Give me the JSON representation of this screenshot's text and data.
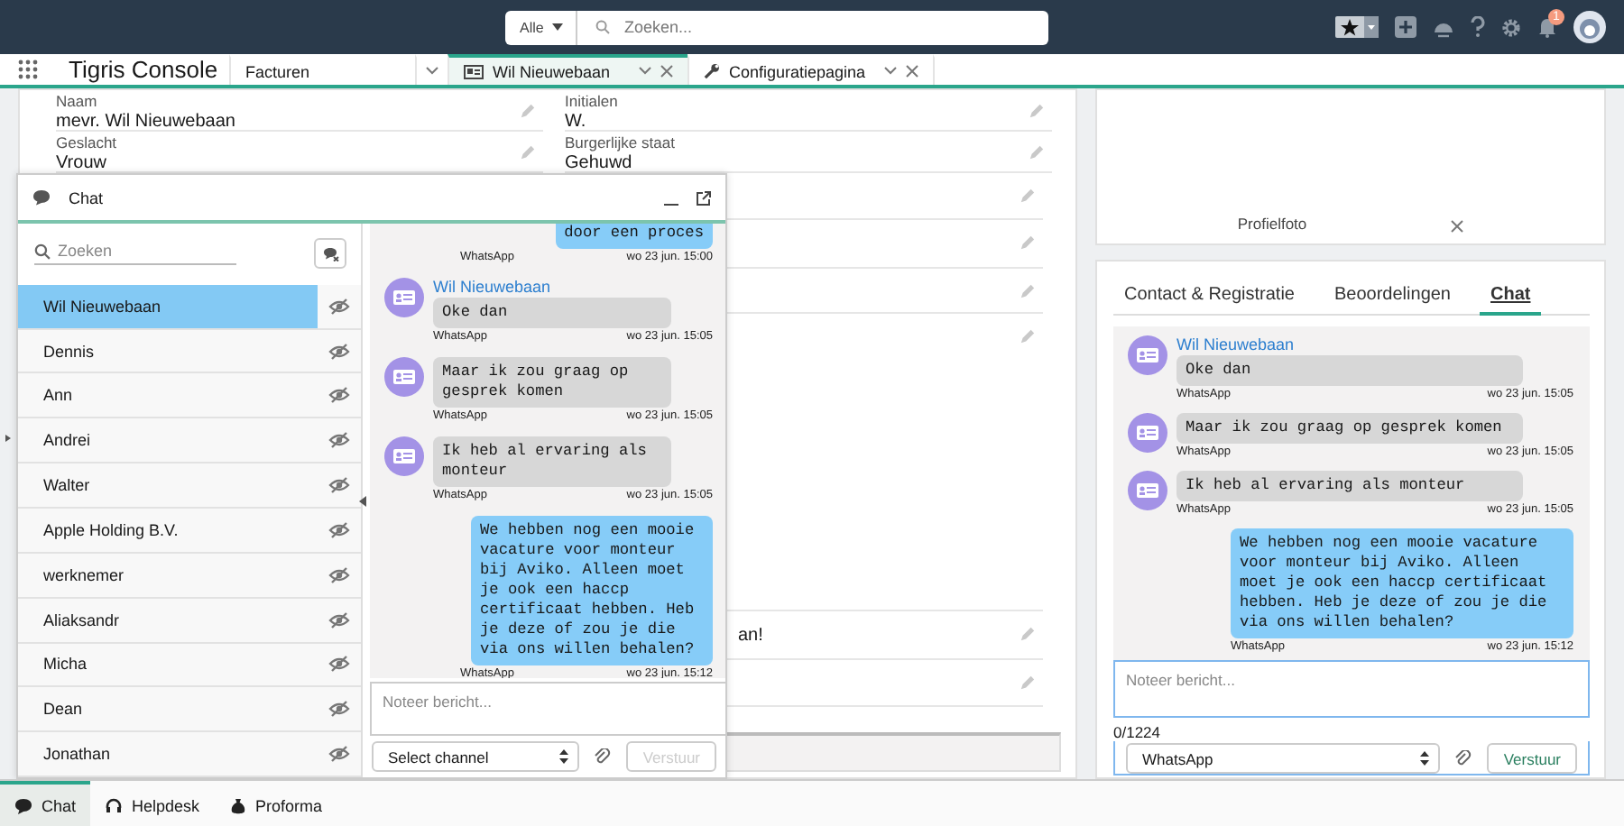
{
  "top_bar": {
    "search_scope": "Alle",
    "search_placeholder": "Zoeken...",
    "notification_count": "1"
  },
  "app": {
    "name": "Tigris Console"
  },
  "tabs": [
    {
      "label": "Facturen",
      "kind": "plain",
      "selected": false
    },
    {
      "label": "Wil Nieuwebaan",
      "kind": "record",
      "selected": true
    },
    {
      "label": "Configuratiepagina",
      "kind": "settings",
      "selected": false
    }
  ],
  "record": {
    "fields": [
      {
        "label": "Naam",
        "value": "mevr. Wil Nieuwebaan"
      },
      {
        "label": "Initialen",
        "value": "W."
      },
      {
        "label": "Geslacht",
        "value": "Vrouw"
      },
      {
        "label": "Burgerlijke staat",
        "value": "Gehuwd"
      }
    ],
    "partial_value": "an!"
  },
  "profile_card": {
    "label": "Profielfoto"
  },
  "detail_tabs": [
    {
      "label": "Contact & Registratie",
      "selected": false
    },
    {
      "label": "Beoordelingen",
      "selected": false
    },
    {
      "label": "Chat",
      "selected": true
    }
  ],
  "detail_chat": {
    "messages": [
      {
        "kind": "incoming",
        "sender": "Wil Nieuwebaan",
        "text": "Oke dan",
        "channel": "WhatsApp",
        "time": "wo 23 jun. 15:05"
      },
      {
        "kind": "incoming",
        "text": "Maar ik zou graag op gesprek komen",
        "channel": "WhatsApp",
        "time": "wo 23 jun. 15:05"
      },
      {
        "kind": "incoming",
        "text": "Ik heb al ervaring als monteur",
        "channel": "WhatsApp",
        "time": "wo 23 jun. 15:05"
      },
      {
        "kind": "outgoing",
        "text": "We hebben nog een mooie vacature voor monteur bij Aviko. Alleen moet je ook een haccp certificaat hebben. Heb je deze of zou je die via ons willen behalen?",
        "channel": "WhatsApp",
        "time": "wo 23 jun. 15:12"
      }
    ],
    "composer": {
      "placeholder": "Noteer bericht...",
      "counter": "0/1224",
      "channel": "WhatsApp",
      "send": "Verstuur",
      "send_disabled": false
    }
  },
  "chat_window": {
    "title": "Chat",
    "search_placeholder": "Zoeken",
    "contacts": [
      {
        "name": "Wil Nieuwebaan",
        "selected": true
      },
      {
        "name": "Dennis",
        "selected": false
      },
      {
        "name": "Ann",
        "selected": false
      },
      {
        "name": "Andrei",
        "selected": false
      },
      {
        "name": "Walter",
        "selected": false
      },
      {
        "name": "Apple Holding B.V.",
        "selected": false
      },
      {
        "name": "werknemer",
        "selected": false
      },
      {
        "name": "Aliaksandr",
        "selected": false
      },
      {
        "name": "Micha",
        "selected": false
      },
      {
        "name": "Dean",
        "selected": false
      },
      {
        "name": "Jonathan",
        "selected": false
      }
    ],
    "messages": [
      {
        "kind": "outgoing",
        "text": "door een proces",
        "channel": "WhatsApp",
        "time": "wo 23 jun. 15:00"
      },
      {
        "kind": "incoming",
        "sender": "Wil Nieuwebaan",
        "text": "Oke dan",
        "channel": "WhatsApp",
        "time": "wo 23 jun. 15:05"
      },
      {
        "kind": "incoming",
        "text": "Maar ik zou graag op gesprek komen",
        "channel": "WhatsApp",
        "time": "wo 23 jun. 15:05"
      },
      {
        "kind": "incoming",
        "text": "Ik heb al ervaring als monteur",
        "channel": "WhatsApp",
        "time": "wo 23 jun. 15:05"
      },
      {
        "kind": "outgoing",
        "text": "We hebben nog een mooie vacature voor monteur bij Aviko. Alleen moet je ook een haccp certificaat hebben. Heb je deze of zou je die via ons willen behalen?",
        "channel": "WhatsApp",
        "time": "wo 23 jun. 15:12"
      }
    ],
    "composer": {
      "placeholder": "Noteer bericht...",
      "channel": "Select channel",
      "send": "Verstuur",
      "send_disabled": true
    }
  },
  "utility_bar": [
    {
      "label": "Chat",
      "kind": "chat",
      "selected": true
    },
    {
      "label": "Helpdesk",
      "kind": "helpdesk",
      "selected": false
    },
    {
      "label": "Proforma",
      "kind": "proforma",
      "selected": false
    }
  ]
}
